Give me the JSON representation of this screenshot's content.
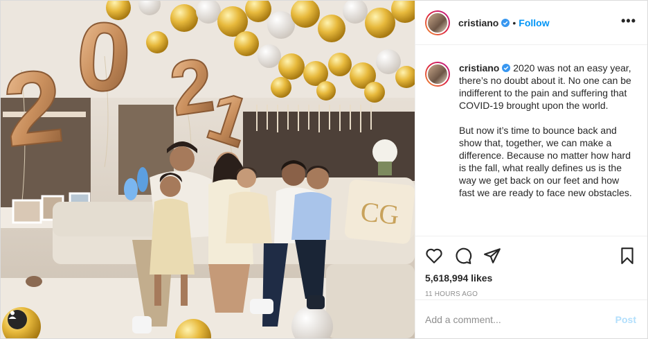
{
  "post": {
    "username": "cristiano",
    "follow_label": "Follow",
    "dot": "•",
    "more_label": "•••",
    "caption_paragraphs": [
      "2020 was not an easy year, there’s no doubt about it. No one can be indifferent to the pain and suffering that COVID-19 brought upon the world.",
      "But now it’s time to bounce back and show that, together, we can make a difference. Because no matter how hard is the fall, what really defines us is the way we get back on our feet and how fast we are ready to face new obstacles."
    ],
    "likes": "5,618,994 likes",
    "time": "11 HOURS AGO",
    "comment_placeholder": "Add a comment...",
    "post_label": "Post"
  },
  "photo": {
    "balloon_digits": [
      "0",
      "2",
      "2",
      "1"
    ],
    "pillow_monogram": "CG"
  },
  "icons": {
    "verified": "verified-badge-icon",
    "like": "heart-icon",
    "comment": "comment-bubble-icon",
    "share": "paper-plane-icon",
    "save": "bookmark-icon",
    "tag": "user-tag-icon"
  },
  "colors": {
    "accent": "#0095f6",
    "post_disabled": "#b2dffc",
    "muted": "#8e8e8e",
    "balloon_gold": "#e7b93c",
    "balloon_rose": "#c98f5d"
  }
}
